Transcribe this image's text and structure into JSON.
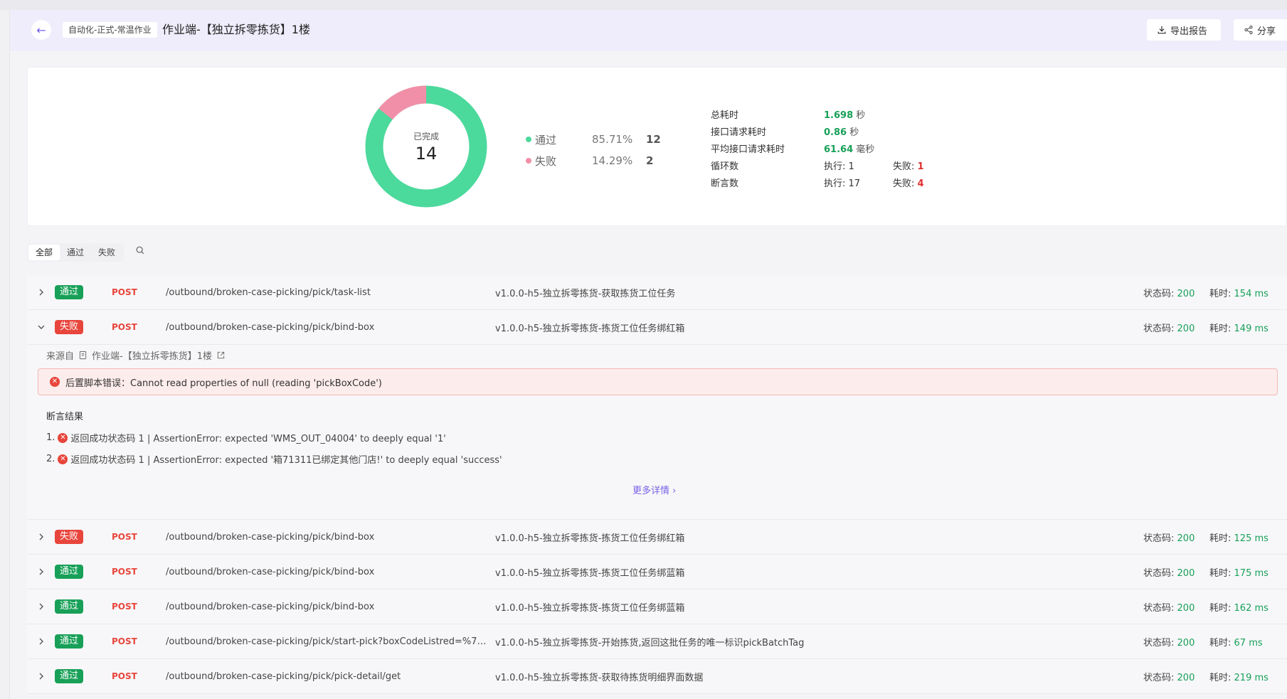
{
  "header": {
    "project_tag": "自动化-正式-常温作业",
    "title": "作业端-【独立拆零拣货】1楼",
    "export_label": "导出报告",
    "share_label": "分享"
  },
  "summary": {
    "donut": {
      "center_label": "已完成",
      "center_value": "14",
      "pass_fraction": 0.8571,
      "fail_fraction": 0.1429,
      "pass_color": "#4cd99c",
      "fail_color": "#f28fa8"
    },
    "legend": [
      {
        "name": "通过",
        "percent": "85.71%",
        "count": "12",
        "color": "#4cd99c"
      },
      {
        "name": "失败",
        "percent": "14.29%",
        "count": "2",
        "color": "#f28fa8"
      }
    ],
    "stats": {
      "total_time_label": "总耗时",
      "total_time_value": "1.698",
      "total_time_unit": "秒",
      "req_time_label": "接口请求耗时",
      "req_time_value": "0.86",
      "req_time_unit": "秒",
      "avg_req_label": "平均接口请求耗时",
      "avg_req_value": "61.64",
      "avg_req_unit": "毫秒",
      "loops_label": "循环数",
      "loops_exec_label": "执行: 1",
      "loops_fail_prefix": "失败:",
      "loops_fail_value": "1",
      "asserts_label": "断言数",
      "asserts_exec_label": "执行: 17",
      "asserts_fail_prefix": "失败:",
      "asserts_fail_value": "4"
    }
  },
  "filters": {
    "all": "全部",
    "pass": "通过",
    "fail": "失败"
  },
  "labels": {
    "status_prefix": "状态码:",
    "time_prefix": "耗时:"
  },
  "rows": [
    {
      "result": "通过",
      "method": "POST",
      "path": "/outbound/broken-case-picking/pick/task-list",
      "desc": "v1.0.0-h5-独立拆零拣货-获取拣货工位任务",
      "status": "200",
      "time": "154 ms"
    },
    {
      "result": "失败",
      "method": "POST",
      "path": "/outbound/broken-case-picking/pick/bind-box",
      "desc": "v1.0.0-h5-独立拆零拣货-拣货工位任务绑红箱",
      "status": "200",
      "time": "149 ms"
    },
    {
      "result": "失败",
      "method": "POST",
      "path": "/outbound/broken-case-picking/pick/bind-box",
      "desc": "v1.0.0-h5-独立拆零拣货-拣货工位任务绑红箱",
      "status": "200",
      "time": "125 ms"
    },
    {
      "result": "通过",
      "method": "POST",
      "path": "/outbound/broken-case-picking/pick/bind-box",
      "desc": "v1.0.0-h5-独立拆零拣货-拣货工位任务绑蓝箱",
      "status": "200",
      "time": "175 ms"
    },
    {
      "result": "通过",
      "method": "POST",
      "path": "/outbound/broken-case-picking/pick/bind-box",
      "desc": "v1.0.0-h5-独立拆零拣货-拣货工位任务绑蓝箱",
      "status": "200",
      "time": "162 ms"
    },
    {
      "result": "通过",
      "method": "POST",
      "path": "/outbound/broken-case-picking/pick/start-pick?boxCodeListred=%7B...",
      "desc": "v1.0.0-h5-独立拆零拣货-开始拣货,返回这批任务的唯一标识pickBatchTag",
      "status": "200",
      "time": "67 ms"
    },
    {
      "result": "通过",
      "method": "POST",
      "path": "/outbound/broken-case-picking/pick/pick-detail/get",
      "desc": "v1.0.0-h5-独立拆零拣货-获取待拣货明细界面数据",
      "status": "200",
      "time": "219 ms"
    }
  ],
  "expanded": {
    "source_label": "来源自",
    "source_value": "作业端-【独立拆零拣货】1楼",
    "error_text": "后置脚本错误：Cannot read properties of null (reading 'pickBoxCode')",
    "assert_title": "断言结果",
    "assert_1_index": "1.",
    "assert_1_text": "返回成功状态码 1 | AssertionError: expected 'WMS_OUT_04004' to deeply equal '1'",
    "assert_2_index": "2.",
    "assert_2_text": "返回成功状态码 1 | AssertionError: expected '箱71311已绑定其他门店!' to deeply equal 'success'",
    "more_label": "更多详情 ›"
  }
}
